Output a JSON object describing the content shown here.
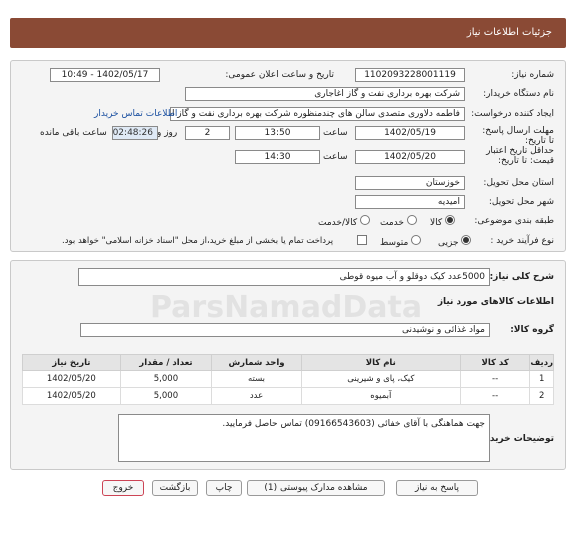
{
  "header": {
    "title": "جزئیات اطلاعات نیاز"
  },
  "info": {
    "need_number_label": "شماره نیاز:",
    "need_number": "1102093228001119",
    "announce_label": "تاریخ و ساعت اعلان عمومی:",
    "announce_value": "1402/05/17 - 10:49",
    "buyer_org_label": "نام دستگاه خریدار:",
    "buyer_org": "شرکت بهره برداری نفت و گاز اغاجاری",
    "requester_label": "ایجاد کننده درخواست:",
    "requester": "فاطمه دلاوری متصدی سالن های چندمنظوره شرکت بهره برداری نفت و گاز اغاجاری",
    "contact_link": "اطلاعات تماس خریدار",
    "deadline_label": "مهلت ارسال پاسخ: تا تاریخ:",
    "deadline_date": "1402/05/19",
    "time_label": "ساعت",
    "deadline_time": "13:50",
    "days_value": "2",
    "days_label": "روز و",
    "timer": "02:48:26",
    "remaining_label": "ساعت باقی مانده",
    "validity_label": "حداقل تاریخ اعتبار قیمت: تا تاریخ:",
    "validity_date": "1402/05/20",
    "validity_time_label": "ساعت",
    "validity_time": "14:30",
    "province_label": "استان محل تحویل:",
    "province": "خوزستان",
    "city_label": "شهر محل تحویل:",
    "city": "امیدیه",
    "category_label": "طبقه بندی موضوعی:",
    "category_options": [
      "کالا",
      "خدمت",
      "کالا/خدمت"
    ],
    "process_label": "نوع فرآیند خرید :",
    "process_options": [
      "جزیی",
      "متوسط"
    ],
    "payment_note": "پرداخت تمام یا بخشی از مبلغ خرید،از محل \"اسناد خزانه اسلامی\" خواهد بود."
  },
  "needs": {
    "description_label": "شرح کلی نیاز:",
    "description": "5000عدد کیک دوقلو و آب میوه قوطی",
    "goods_title": "اطلاعات کالاهای مورد نیاز",
    "group_label": "گروه کالا:",
    "group_value": "مواد غذائی و نوشیدنی",
    "table_headers": [
      "ردیف",
      "کد کالا",
      "نام کالا",
      "واحد شمارش",
      "تعداد / مقدار",
      "تاریخ نیاز"
    ],
    "rows": [
      {
        "row": "1",
        "code": "--",
        "name": "کیک، پای و شیرینی",
        "unit": "بسته",
        "qty": "5,000",
        "date": "1402/05/20"
      },
      {
        "row": "2",
        "code": "--",
        "name": "آبمیوه",
        "unit": "عدد",
        "qty": "5,000",
        "date": "1402/05/20"
      }
    ],
    "buyer_notes_label": "توضیحات خریدار:",
    "buyer_notes": "جهت هماهنگی با آقای خفائی (09166543603) تماس حاصل فرمایید."
  },
  "actions": {
    "reply": "پاسخ به نیاز",
    "attachments": "مشاهده مدارک پیوستی (1)",
    "print": "چاپ",
    "back": "بازگشت",
    "exit": "خروج"
  },
  "colors": {
    "header": "#8a4a35",
    "link": "#1a4fa0",
    "panel": "#f4f4f4"
  }
}
